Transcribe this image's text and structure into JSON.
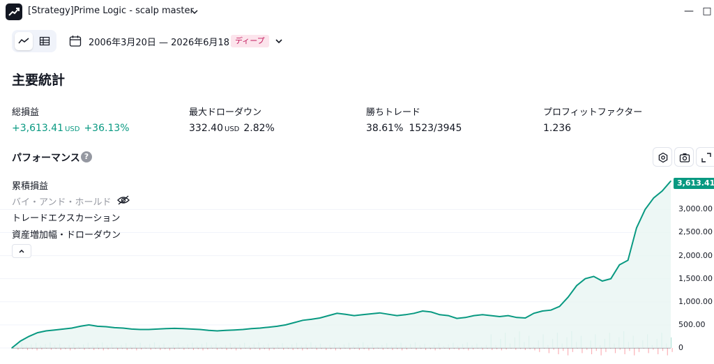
{
  "window": {
    "title": "[Strategy]Prime Logic - scalp master",
    "minimize_label": "—",
    "maximize_label": "□"
  },
  "toolbar": {
    "date_range": "2006年3月20日 — 2026年6月18日",
    "mode_badge": "ディープ"
  },
  "summary": {
    "title": "主要統計",
    "stats": [
      {
        "label": "総損益",
        "value": "+3,613.41",
        "unit": "USD",
        "extra": "+36.13%"
      },
      {
        "label": "最大ドローダウン",
        "value": "332.40",
        "unit": "USD",
        "extra": "2.82%"
      },
      {
        "label": "勝ちトレード",
        "value": "38.61%",
        "unit": "",
        "extra": "1523/3945"
      },
      {
        "label": "プロフィットファクター",
        "value": "1.236",
        "unit": "",
        "extra": ""
      }
    ]
  },
  "performance": {
    "title": "パフォーマンス",
    "help": "?",
    "legend": [
      {
        "label": "累積損益",
        "visible": true
      },
      {
        "label": "バイ・アンド・ホールド",
        "visible": false
      },
      {
        "label": "トレードエクスカーション",
        "visible": true
      },
      {
        "label": "資産増加幅・ドローダウン",
        "visible": true
      }
    ],
    "last_value": "3,613.41",
    "colors": {
      "line": "#089981",
      "fill": "#e8f5f2",
      "loss": "#f7525f"
    }
  },
  "chart_data": {
    "type": "area",
    "ylabel": "",
    "yticks": [
      0,
      500,
      1000,
      1500,
      2000,
      2500,
      3000
    ],
    "ytick_labels": [
      "0",
      "500.00",
      "1,000.00",
      "1,500.00",
      "2,000.00",
      "2,500.00",
      "3,000.00"
    ],
    "ylim": [
      0,
      3700
    ],
    "series": [
      {
        "values": [
          0,
          150,
          250,
          330,
          370,
          390,
          410,
          430,
          470,
          500,
          470,
          460,
          440,
          430,
          410,
          400,
          400,
          410,
          420,
          425,
          420,
          410,
          400,
          380,
          370,
          380,
          390,
          400,
          420,
          430,
          450,
          470,
          500,
          550,
          600,
          620,
          650,
          700,
          750,
          730,
          700,
          720,
          740,
          760,
          730,
          700,
          720,
          750,
          800,
          780,
          720,
          700,
          640,
          660,
          700,
          720,
          700,
          680,
          700,
          660,
          650,
          750,
          800,
          820,
          900,
          1100,
          1350,
          1500,
          1550,
          1450,
          1500,
          1800,
          1900,
          2600,
          3000,
          3250,
          3400,
          3613.41
        ]
      }
    ]
  }
}
